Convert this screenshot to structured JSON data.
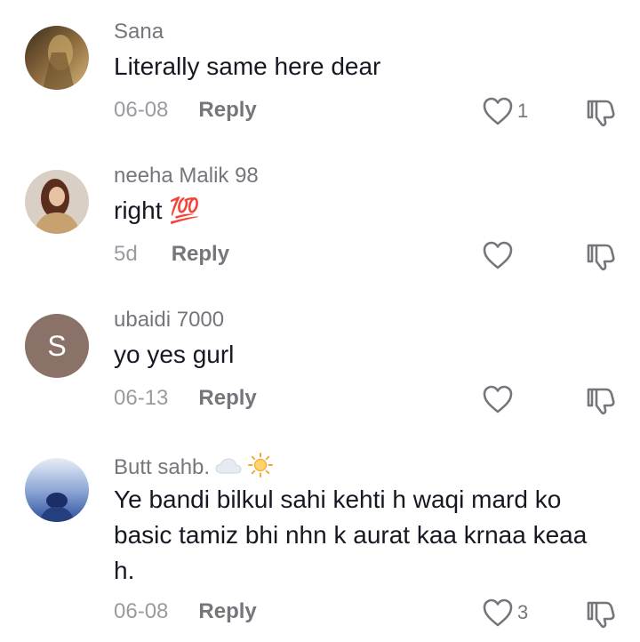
{
  "comments": [
    {
      "username": "Sana",
      "text": "Literally same here dear",
      "date": "06-08",
      "reply_label": "Reply",
      "likes": "1",
      "avatar": "photo-avatar"
    },
    {
      "username": "neeha Malik 98",
      "text": "right 💯",
      "date": "5d",
      "reply_label": "Reply",
      "likes": "",
      "avatar": "photo-avatar"
    },
    {
      "username": "ubaidi 7000",
      "text": "yo yes gurl",
      "date": "06-13",
      "reply_label": "Reply",
      "likes": "",
      "avatar_letter": "S",
      "avatar_color": "#8a7268"
    },
    {
      "username": "Butt sahb.",
      "username_icons": [
        "cloud-icon",
        "sun-icon"
      ],
      "text": "Ye bandi bilkul sahi kehti h waqi mard ko basic tamiz bhi nhn k aurat kaa krnaa keaa h.",
      "date": "06-08",
      "reply_label": "Reply",
      "likes": "3",
      "avatar": "photo-avatar"
    }
  ],
  "colors": {
    "primary_text": "#161823",
    "secondary_text": "#75767c",
    "date_text": "#9a9ba1",
    "icon_stroke": "#75767c",
    "emoji_red": "#e0242b"
  }
}
